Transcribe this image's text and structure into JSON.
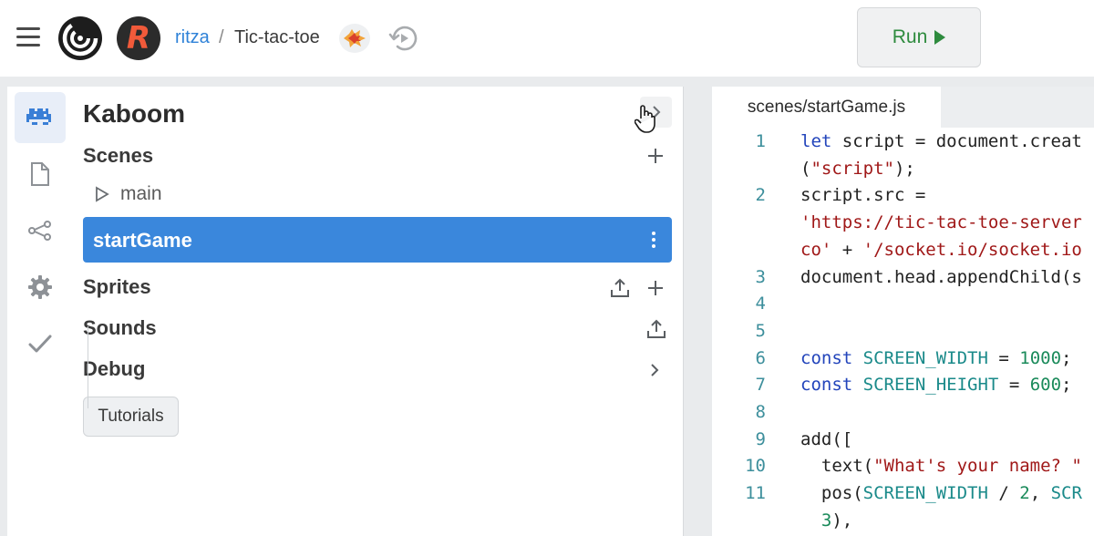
{
  "header": {
    "user": "ritza",
    "separator": "/",
    "repo": "Tic-tac-toe",
    "avatar_letter": "R",
    "run_label": "Run",
    "accent_link_color": "#2f82d8",
    "run_color": "#2e8b3e"
  },
  "rail": {
    "items": [
      "kaboom-icon",
      "file-icon",
      "share-icon",
      "gear-icon",
      "check-icon"
    ],
    "active": "kaboom-icon"
  },
  "panel": {
    "title": "Kaboom",
    "sections": {
      "scenes": "Scenes",
      "sprites": "Sprites",
      "sounds": "Sounds",
      "debug": "Debug"
    },
    "scenes": [
      {
        "label": "main",
        "selected": false
      },
      {
        "label": "startGame",
        "selected": true
      }
    ],
    "tutorials_label": "Tutorials",
    "selection_color": "#3a87dc"
  },
  "editor": {
    "tab": "scenes/startGame.js",
    "lines": [
      {
        "n": "1",
        "segments": [
          [
            "kw",
            "let"
          ],
          [
            "p",
            " script = document.creat"
          ]
        ]
      },
      {
        "n": "",
        "segments": [
          [
            "p",
            "("
          ],
          [
            "st",
            "\"script\""
          ],
          [
            "p",
            ");"
          ]
        ]
      },
      {
        "n": "2",
        "segments": [
          [
            "p",
            "script.src ="
          ]
        ]
      },
      {
        "n": "",
        "segments": [
          [
            "st",
            "'https://tic-tac-toe-server"
          ]
        ]
      },
      {
        "n": "",
        "segments": [
          [
            "st",
            "co'"
          ],
          [
            "p",
            " + "
          ],
          [
            "st",
            "'/socket.io/socket.io"
          ]
        ]
      },
      {
        "n": "3",
        "segments": [
          [
            "p",
            "document.head.appendChild(s"
          ]
        ]
      },
      {
        "n": "4",
        "segments": []
      },
      {
        "n": "5",
        "segments": []
      },
      {
        "n": "6",
        "segments": [
          [
            "kw",
            "const"
          ],
          [
            "p",
            " "
          ],
          [
            "cn",
            "SCREEN_WIDTH"
          ],
          [
            "p",
            " = "
          ],
          [
            "nm",
            "1000"
          ],
          [
            "p",
            ";"
          ]
        ]
      },
      {
        "n": "7",
        "segments": [
          [
            "kw",
            "const"
          ],
          [
            "p",
            " "
          ],
          [
            "cn",
            "SCREEN_HEIGHT"
          ],
          [
            "p",
            " = "
          ],
          [
            "nm",
            "600"
          ],
          [
            "p",
            ";"
          ]
        ]
      },
      {
        "n": "8",
        "segments": []
      },
      {
        "n": "9",
        "segments": [
          [
            "p",
            "add(["
          ]
        ]
      },
      {
        "n": "10",
        "segments": [
          [
            "p",
            "  text("
          ],
          [
            "st",
            "\"What's your name? \""
          ]
        ]
      },
      {
        "n": "11",
        "segments": [
          [
            "p",
            "  pos("
          ],
          [
            "cn",
            "SCREEN_WIDTH"
          ],
          [
            "p",
            " / "
          ],
          [
            "nm",
            "2"
          ],
          [
            "p",
            ", "
          ],
          [
            "cn",
            "SCR"
          ]
        ]
      },
      {
        "n": "",
        "segments": [
          [
            "nm",
            "  3"
          ],
          [
            "p",
            "),"
          ]
        ]
      }
    ]
  }
}
